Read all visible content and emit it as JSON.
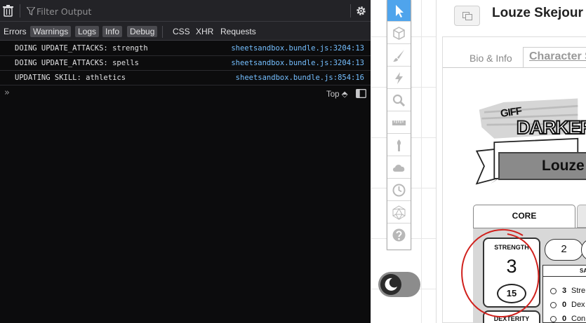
{
  "devtools": {
    "filter_placeholder": "Filter Output",
    "categories": [
      {
        "label": "Errors",
        "active": false
      },
      {
        "label": "Warnings",
        "active": true
      },
      {
        "label": "Logs",
        "active": true
      },
      {
        "label": "Info",
        "active": true
      },
      {
        "label": "Debug",
        "active": true
      },
      {
        "label": "CSS",
        "active": false
      },
      {
        "label": "XHR",
        "active": false
      },
      {
        "label": "Requests",
        "active": false
      }
    ],
    "logs": [
      {
        "message": "DOING UPDATE_ATTACKS: strength",
        "source": "sheetsandbox.bundle.js:3204:13"
      },
      {
        "message": "DOING UPDATE_ATTACKS: spells",
        "source": "sheetsandbox.bundle.js:3204:13"
      },
      {
        "message": "UPDATING SKILL: athletics",
        "source": "sheetsandbox.bundle.js:854:16"
      }
    ],
    "prompt": "»",
    "context": "Top ⬘",
    "colors": {
      "background": "#0c0c0d",
      "toolbar": "#232327",
      "link": "#75bfff"
    }
  },
  "toolbar": {
    "tools": [
      "select-icon",
      "cube-icon",
      "brush-icon",
      "lightning-icon",
      "zoom-icon",
      "ruler-icon",
      "torch-icon",
      "cloud-icon",
      "clock-icon",
      "d20-icon",
      "help-icon"
    ],
    "active_color": "#4fa4ec"
  },
  "sheet": {
    "title": "Louze Skejour",
    "tabs": {
      "bio": "Bio & Info",
      "character": "Character S"
    },
    "logo": {
      "top": "GIFF",
      "main": "DARKERS"
    },
    "name_field": "Louze",
    "subtabs": {
      "core": "CORE"
    },
    "stat": {
      "label": "STRENGTH",
      "value": "3",
      "score": "15"
    },
    "next_stat": {
      "label": "DEXTERITY"
    },
    "pill_value": "2",
    "saves_header": "SA",
    "saves": [
      {
        "value": "3",
        "name": "Stre"
      },
      {
        "value": "0",
        "name": "Dex"
      },
      {
        "value": "0",
        "name": "Con"
      }
    ],
    "annotation_color": "#d0201c"
  }
}
